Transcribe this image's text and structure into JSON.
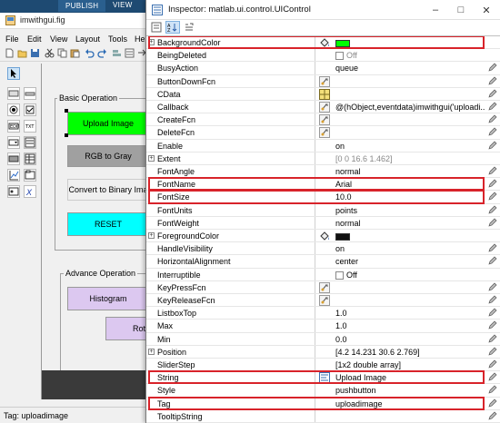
{
  "guide": {
    "ribbon_tabs": [
      "PUBLISH",
      "VIEW"
    ],
    "title": "imwithgui.fig",
    "menu": [
      "File",
      "Edit",
      "View",
      "Layout",
      "Tools",
      "He"
    ],
    "panels": {
      "basic": "Basic Operation",
      "advance": "Advance Operation"
    },
    "buttons": {
      "upload": "Upload Image",
      "rgb": "RGB to Gray",
      "binary": "Convert to Binary Ima",
      "reset": "RESET",
      "histogram": "Histogram",
      "rot": "Rot"
    },
    "status": "Tag: uploadimage",
    "colors": {
      "upload": "#00ff00",
      "reset": "#00ffff",
      "histogram": "#dcc8f0",
      "rot": "#dcc8f0",
      "rgb": "#a0a0a0"
    }
  },
  "inspector": {
    "title": "Inspector:  matlab.ui.control.UIControl",
    "properties": [
      {
        "name": "BackgroundColor",
        "expand": true,
        "icon": "paint-bucket-icon",
        "value": "",
        "swatch": "#00ff00",
        "highlight": true
      },
      {
        "name": "BeingDeleted",
        "value": "Off",
        "checkbox": true,
        "grey": true
      },
      {
        "name": "BusyAction",
        "value": "queue",
        "pen": true
      },
      {
        "name": "ButtonDownFcn",
        "icon": "callback-icon",
        "value": "",
        "pen": true
      },
      {
        "name": "CData",
        "icon": "grid-icon",
        "value": "",
        "pen": true
      },
      {
        "name": "Callback",
        "icon": "callback-icon",
        "value": "@(hObject,eventdata)imwithgui('uploadi...",
        "pen": true
      },
      {
        "name": "CreateFcn",
        "icon": "callback-icon",
        "value": "",
        "pen": true
      },
      {
        "name": "DeleteFcn",
        "icon": "callback-icon",
        "value": "",
        "pen": true
      },
      {
        "name": "Enable",
        "value": "on",
        "pen": true
      },
      {
        "name": "Extent",
        "expand": true,
        "value": "[0 0 16.6 1.462]",
        "grey": true
      },
      {
        "name": "FontAngle",
        "value": "normal",
        "pen": true
      },
      {
        "name": "FontName",
        "value": "Arial",
        "pen": true,
        "highlight": true
      },
      {
        "name": "FontSize",
        "value": "10.0",
        "pen": true,
        "highlight": true
      },
      {
        "name": "FontUnits",
        "value": "points",
        "pen": true
      },
      {
        "name": "FontWeight",
        "value": "normal",
        "pen": true
      },
      {
        "name": "ForegroundColor",
        "expand": true,
        "icon": "paint-bucket-icon",
        "value": "",
        "swatch": "#111111"
      },
      {
        "name": "HandleVisibility",
        "value": "on",
        "pen": true
      },
      {
        "name": "HorizontalAlignment",
        "value": "center",
        "pen": true
      },
      {
        "name": "Interruptible",
        "value": "Off",
        "checkbox": true
      },
      {
        "name": "KeyPressFcn",
        "icon": "callback-icon",
        "value": "",
        "pen": true
      },
      {
        "name": "KeyReleaseFcn",
        "icon": "callback-icon",
        "value": "",
        "pen": true
      },
      {
        "name": "ListboxTop",
        "value": "1.0",
        "pen": true
      },
      {
        "name": "Max",
        "value": "1.0",
        "pen": true
      },
      {
        "name": "Min",
        "value": "0.0",
        "pen": true
      },
      {
        "name": "Position",
        "expand": true,
        "value": "[4.2 14.231 30.6 2.769]",
        "pen": true
      },
      {
        "name": "SliderStep",
        "value": "[1x2  double array]",
        "pen": true
      },
      {
        "name": "String",
        "icon": "text-editor-icon",
        "value": "Upload Image",
        "pen": true,
        "highlight": true
      },
      {
        "name": "Style",
        "value": "pushbutton",
        "pen": true
      },
      {
        "name": "Tag",
        "value": "uploadimage",
        "pen": true,
        "highlight": true
      },
      {
        "name": "TooltipString",
        "value": "",
        "pen": true
      }
    ]
  }
}
